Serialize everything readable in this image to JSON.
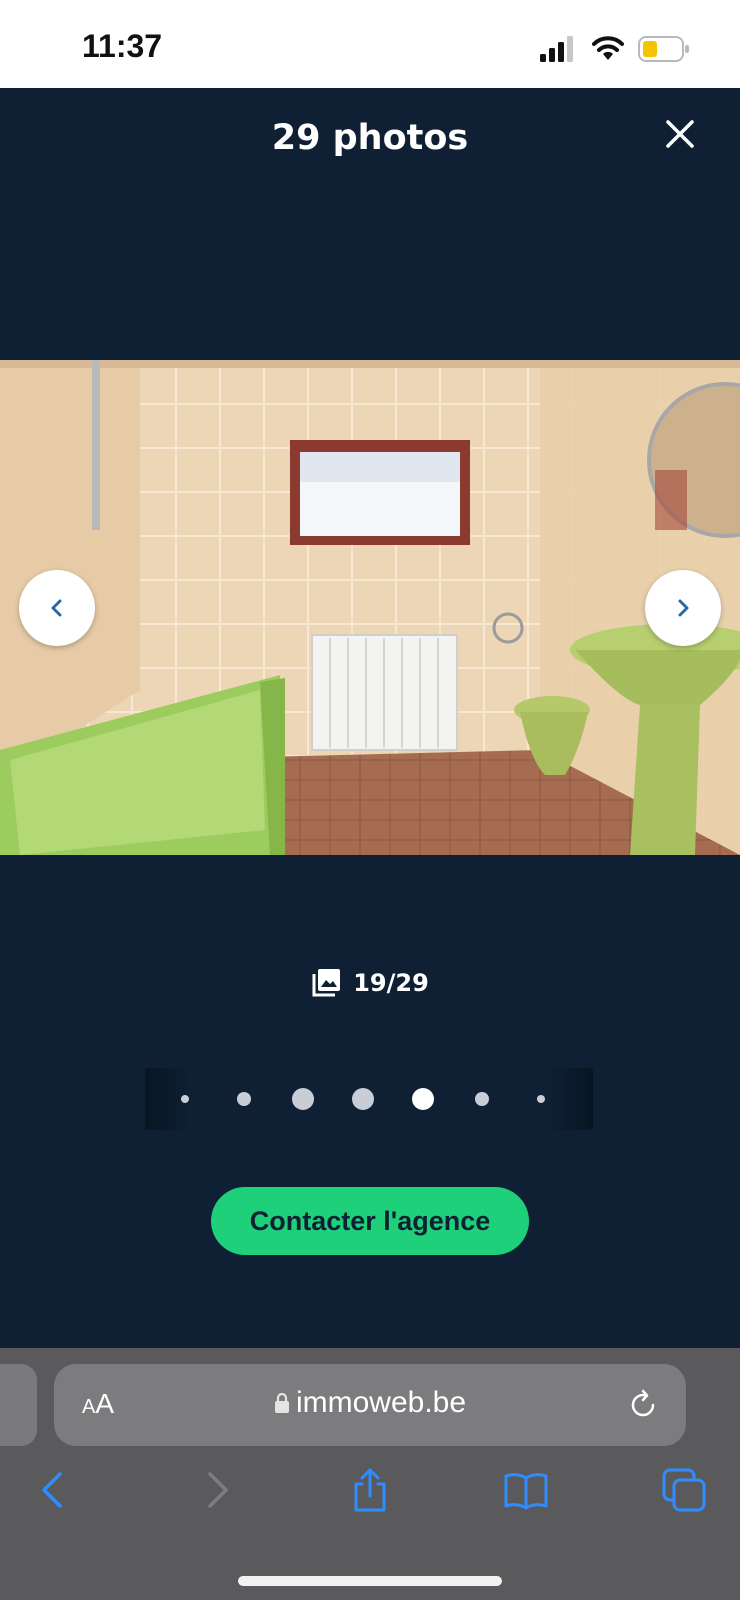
{
  "status_bar": {
    "time": "11:37"
  },
  "gallery": {
    "title": "29 photos",
    "counter": "19/29",
    "contact_label": "Contacter l'agence",
    "dots": {
      "count": 7,
      "active_index": 4
    }
  },
  "browser": {
    "text_size_small": "A",
    "text_size_large": "A",
    "url": "immoweb.be"
  },
  "colors": {
    "background": "#0f2034",
    "accent": "#1fd07b",
    "nav_arrow_glyph": "#2b6aa8"
  }
}
